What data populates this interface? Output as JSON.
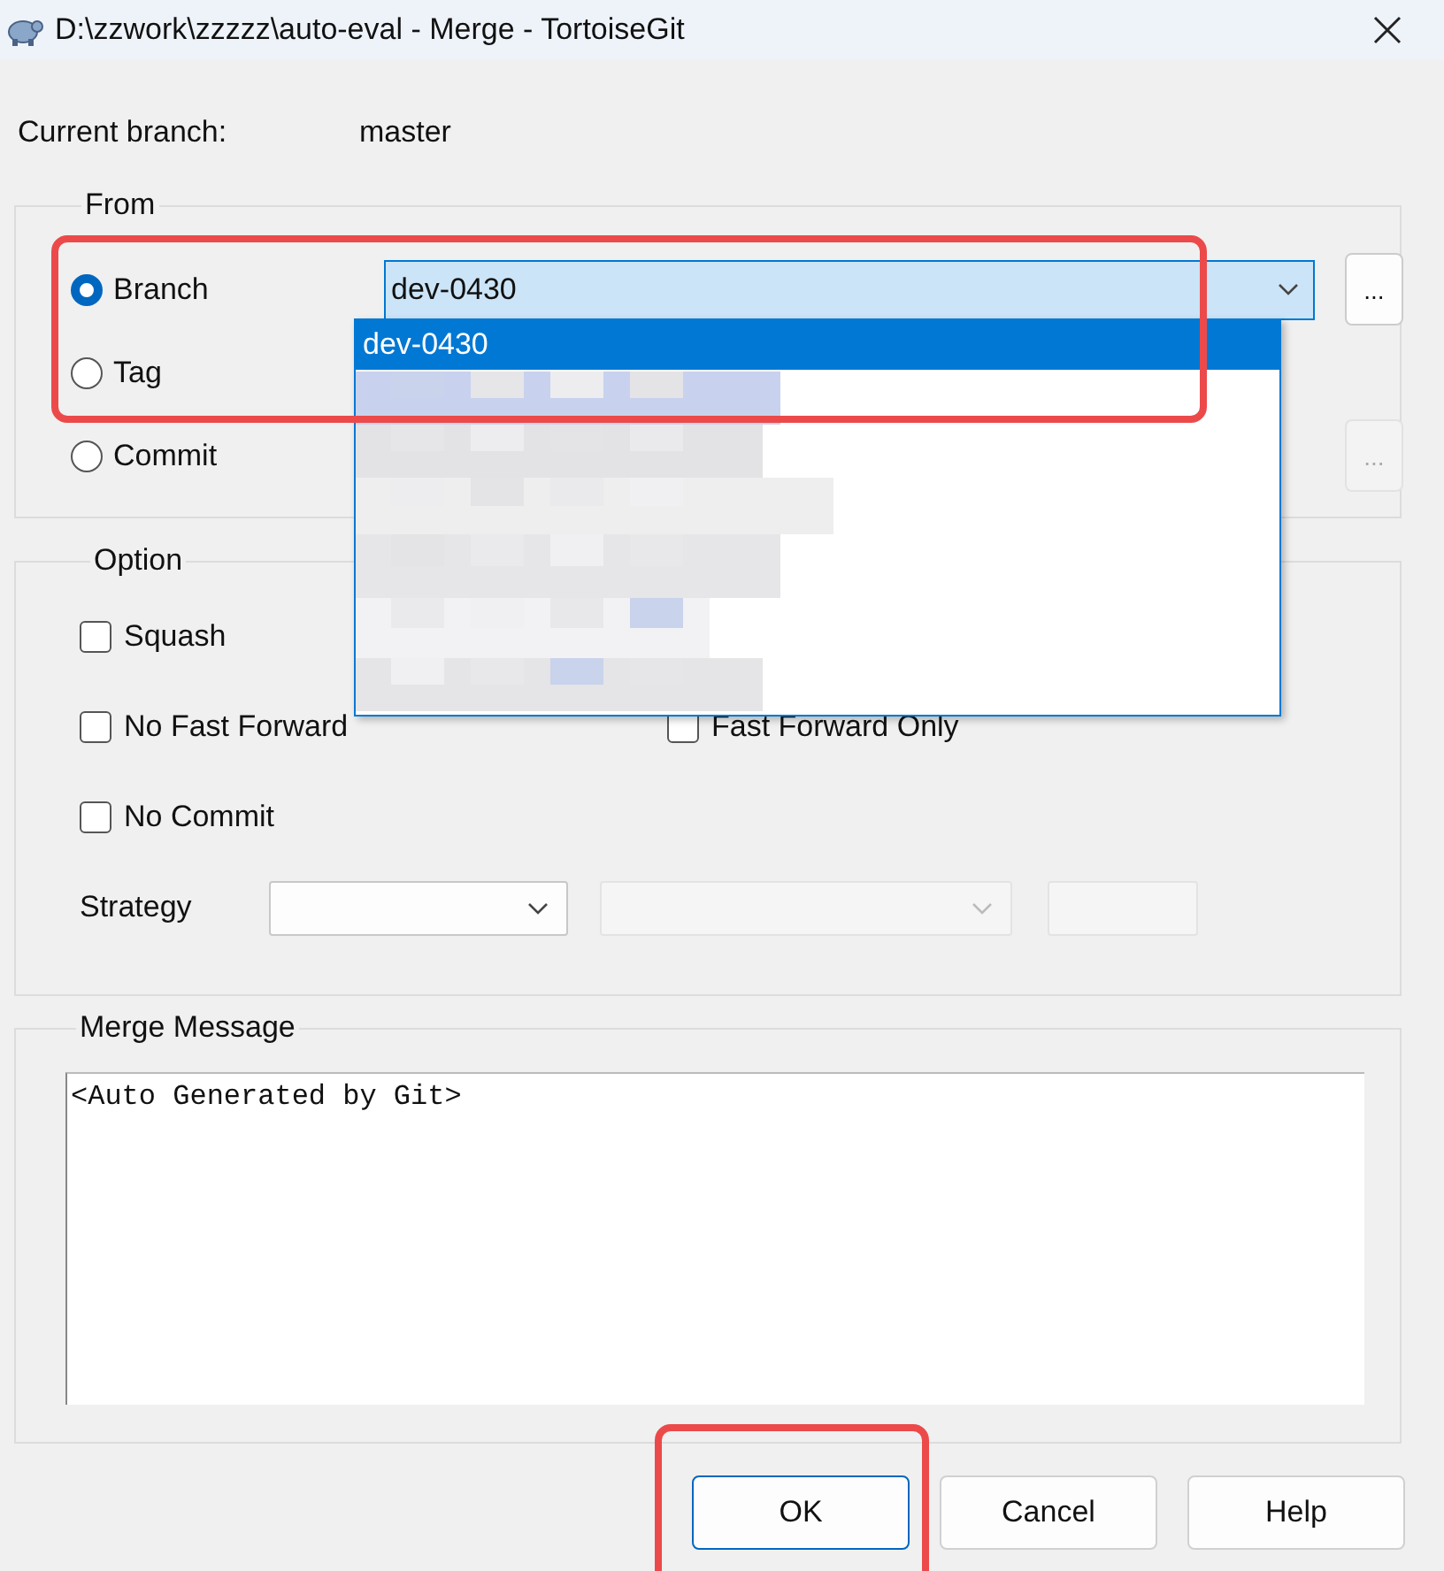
{
  "window": {
    "title": "D:\\zzwork\\zzzzz\\auto-eval - Merge - TortoiseGit"
  },
  "current_branch": {
    "label": "Current branch:",
    "value": "master"
  },
  "from": {
    "title": "From",
    "sources": [
      {
        "label": "Branch",
        "selected": true
      },
      {
        "label": "Tag",
        "selected": false
      },
      {
        "label": "Commit",
        "selected": false
      }
    ],
    "branch_field": {
      "value": "dev-0430",
      "expanded": true
    },
    "dropdown_items": [
      {
        "label": "dev-0430",
        "selected": true
      }
    ],
    "browse_buttons": [
      {
        "label": "...",
        "disabled": false
      },
      {
        "label": "...",
        "disabled": true
      }
    ]
  },
  "option": {
    "title": "Option",
    "checkboxes": [
      {
        "label": "Squash",
        "checked": false
      },
      {
        "label": "No Fast Forward",
        "checked": false
      },
      {
        "label": "Fast Forward Only",
        "checked": false
      },
      {
        "label": "No Commit",
        "checked": false
      }
    ],
    "strategy_label": "Strategy",
    "strategy_fields": [
      {
        "kind": "combo",
        "disabled": false
      },
      {
        "kind": "combo",
        "disabled": true
      },
      {
        "kind": "text",
        "disabled": true
      }
    ]
  },
  "merge_message": {
    "title": "Merge Message",
    "value": "<Auto Generated by Git>"
  },
  "buttons": [
    {
      "label": "OK",
      "default": true
    },
    {
      "label": "Cancel",
      "default": false
    },
    {
      "label": "Help",
      "default": false
    }
  ],
  "annotation_boxes": [
    {
      "kind": "highlight"
    },
    {
      "kind": "highlight"
    }
  ]
}
